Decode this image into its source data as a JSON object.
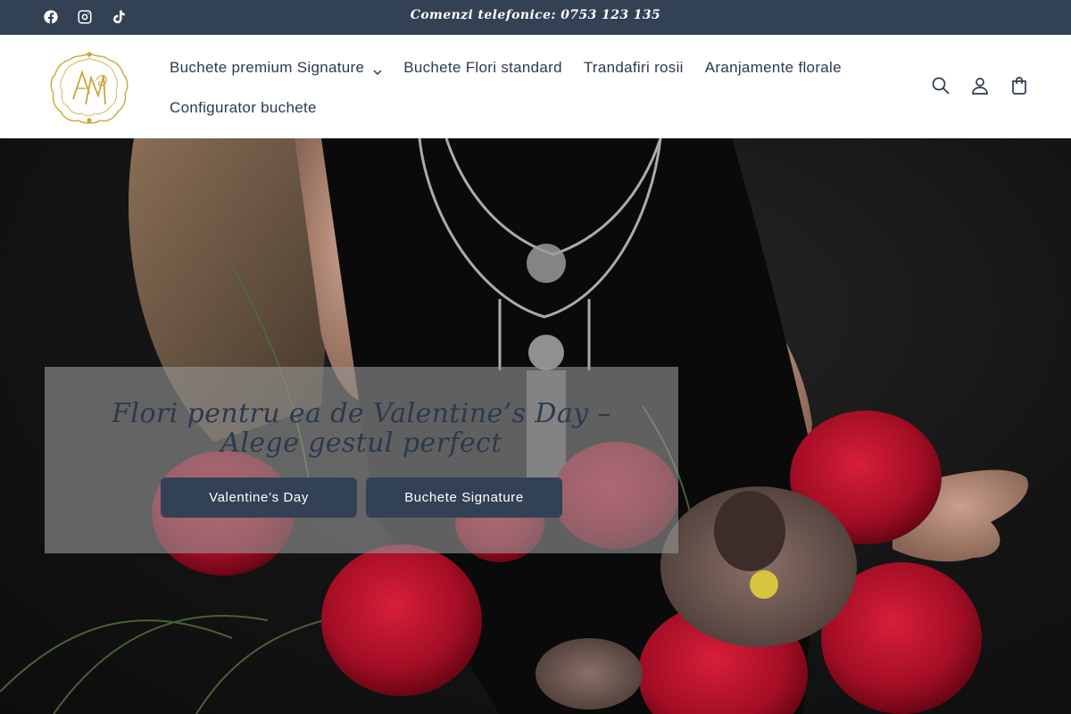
{
  "announcement": {
    "text": "Comenzi telefonice: 0753 123 135",
    "social": [
      {
        "icon": "facebook-icon"
      },
      {
        "icon": "instagram-icon"
      },
      {
        "icon": "tiktok-icon"
      }
    ]
  },
  "header": {
    "logo_icon": "monogram-logo",
    "nav": [
      {
        "label": "Buchete premium Signature",
        "has_dropdown": true
      },
      {
        "label": "Buchete Flori standard"
      },
      {
        "label": "Trandafiri rosii"
      },
      {
        "label": "Aranjamente florale"
      },
      {
        "label": "Configurator buchete"
      }
    ],
    "icons": [
      "search-icon",
      "account-icon",
      "cart-icon"
    ]
  },
  "hero": {
    "title": "Flori pentru ea de Valentine’s Day – Alege gestul perfect",
    "buttons": [
      {
        "label": "Valentine’s Day"
      },
      {
        "label": "Buchete Signature"
      }
    ]
  },
  "colors": {
    "accent": "#334155",
    "text": "#2b3a4d",
    "logo_gold": "#c9a63a"
  }
}
